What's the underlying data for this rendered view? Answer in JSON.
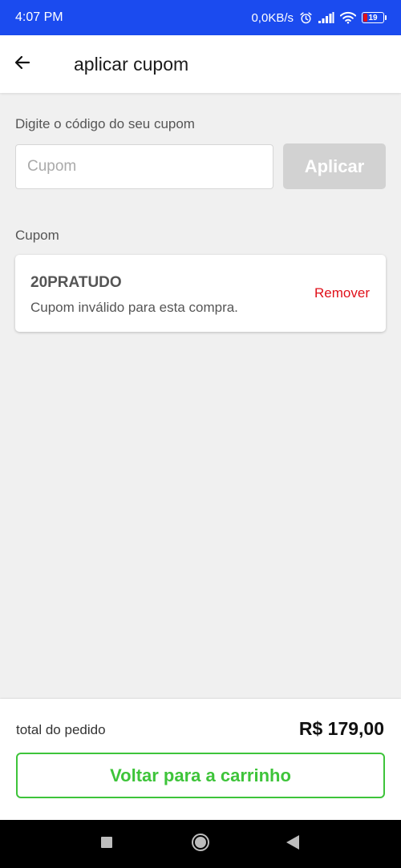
{
  "status_bar": {
    "time": "4:07 PM",
    "network_speed": "0,0KB/s",
    "battery_level": "19",
    "battery_fraction": 0.19,
    "icons": [
      "alarm-icon",
      "signal-icon",
      "wifi-icon",
      "battery-icon"
    ]
  },
  "app_bar": {
    "title": "aplicar cupom",
    "back_icon": "arrow-left-icon"
  },
  "form": {
    "prompt": "Digite o código do seu cupom",
    "input_placeholder": "Cupom",
    "input_value": "",
    "apply_label": "Aplicar"
  },
  "coupon_section": {
    "label": "Cupom",
    "coupon": {
      "code": "20PRATUDO",
      "message": "Cupom inválido para esta compra.",
      "remove_label": "Remover"
    }
  },
  "footer": {
    "total_label": "total do pedido",
    "total_value": "R$ 179,00",
    "back_button_label": "Voltar para a carrinho"
  },
  "colors": {
    "status_bar": "#1b4bef",
    "accent_green": "#3ec43a",
    "remove_red": "#e0101a",
    "disabled_button": "#d2d2d2",
    "background": "#f0f0f0"
  },
  "nav_bar": {
    "icons": [
      "square-recents-icon",
      "circle-home-icon",
      "triangle-back-icon"
    ]
  }
}
